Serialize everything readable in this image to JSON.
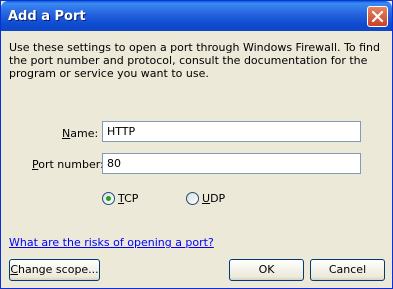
{
  "window": {
    "title": "Add a Port"
  },
  "description": "Use these settings to open a port through Windows Firewall. To find the port number and protocol, consult the documentation for the program or service you want to use.",
  "name_field": {
    "label_access": "N",
    "label_rest": "ame:",
    "value": "HTTP"
  },
  "port_field": {
    "label_access": "P",
    "label_rest": "ort number:",
    "value": "80"
  },
  "protocol": {
    "tcp": {
      "access": "T",
      "rest": "CP",
      "checked": true
    },
    "udp": {
      "access": "U",
      "rest": "DP",
      "checked": false
    }
  },
  "risk_link": "What are the risks of opening a port?",
  "buttons": {
    "change_scope": {
      "access": "C",
      "rest": "hange scope..."
    },
    "ok": "OK",
    "cancel": "Cancel"
  },
  "icons": {
    "close": "close-icon",
    "radio_selected": "radio-selected-icon"
  },
  "colors": {
    "title_bar": "#0f4cd1",
    "close_button": "#c9402a",
    "link": "#0000ff"
  }
}
